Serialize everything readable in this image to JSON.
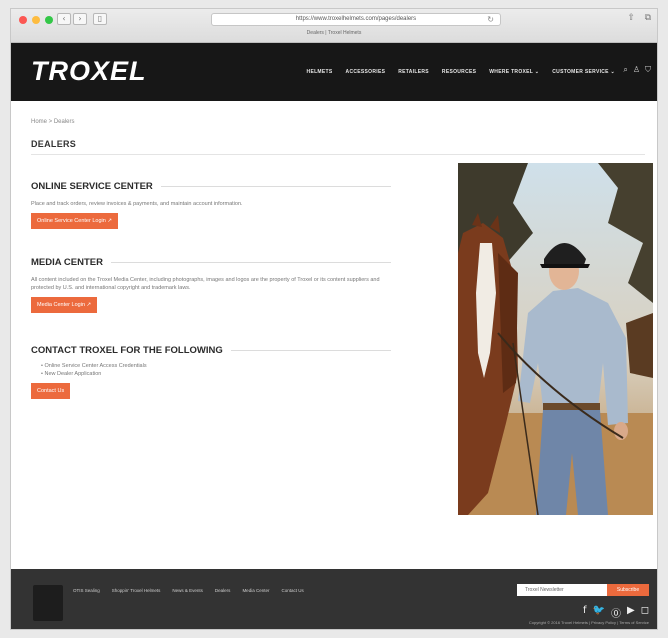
{
  "browser": {
    "url": "https://www.troxelhelmets.com/pages/dealers",
    "tab_title": "Dealers | Troxel Helmets",
    "back_glyph": "‹",
    "forward_glyph": "›",
    "sidebar_glyph": "▯",
    "reload_glyph": "↻",
    "share_glyph": "⇧",
    "tabs_glyph": "⧉",
    "traffic_colors": [
      "#fc5753",
      "#fdbc40",
      "#33c748"
    ]
  },
  "header": {
    "logo": "TROXEL",
    "nav": [
      "HELMETS",
      "ACCESSORIES",
      "RETAILERS",
      "RESOURCES",
      "WHERE TROXEL ⌄",
      "CUSTOMER SERVICE ⌄"
    ],
    "icons": [
      "search-icon",
      "account-icon",
      "cart-icon"
    ],
    "icon_glyphs": [
      "⌕",
      "♙",
      "⛉"
    ]
  },
  "page": {
    "breadcrumb": "Home > Dealers",
    "title": "DEALERS"
  },
  "sections": {
    "online": {
      "title": "ONLINE SERVICE CENTER",
      "text": "Place and track orders, review invoices & payments, and maintain account information.",
      "button": "Online Service Center Login ↗"
    },
    "media": {
      "title": "MEDIA CENTER",
      "text": "All content included on the Troxel Media Center, including photographs, images and logos are the property of Troxel or its content suppliers and protected by U.S. and international copyright and trademark laws.",
      "button": "Media Center Login ↗"
    },
    "contact": {
      "title": "CONTACT TROXEL FOR THE FOLLOWING",
      "items": [
        "Online Service Center Access Credentials",
        "New Dealer Application"
      ],
      "button": "Contact Us"
    }
  },
  "footer": {
    "nav": [
      "OTIS Sealing",
      "Shoppin' Troxel Helmets",
      "News & Events",
      "Dealers",
      "Media Center",
      "Contact Us"
    ],
    "newsletter_placeholder": "Troxel Newsletter",
    "subscribe": "Subscribe",
    "social": [
      "facebook-icon",
      "twitter-icon",
      "pinterest-icon",
      "youtube-icon",
      "instagram-icon"
    ],
    "social_glyphs": [
      "f",
      "🐦",
      "⓪",
      "▶",
      "◻"
    ],
    "copyright": "Copyright © 2016 Troxel Helmets | Privacy Policy | Terms of Service"
  },
  "colors": {
    "accent": "#ec6a3d",
    "header_bg": "#171717",
    "footer_bg": "#333333"
  }
}
